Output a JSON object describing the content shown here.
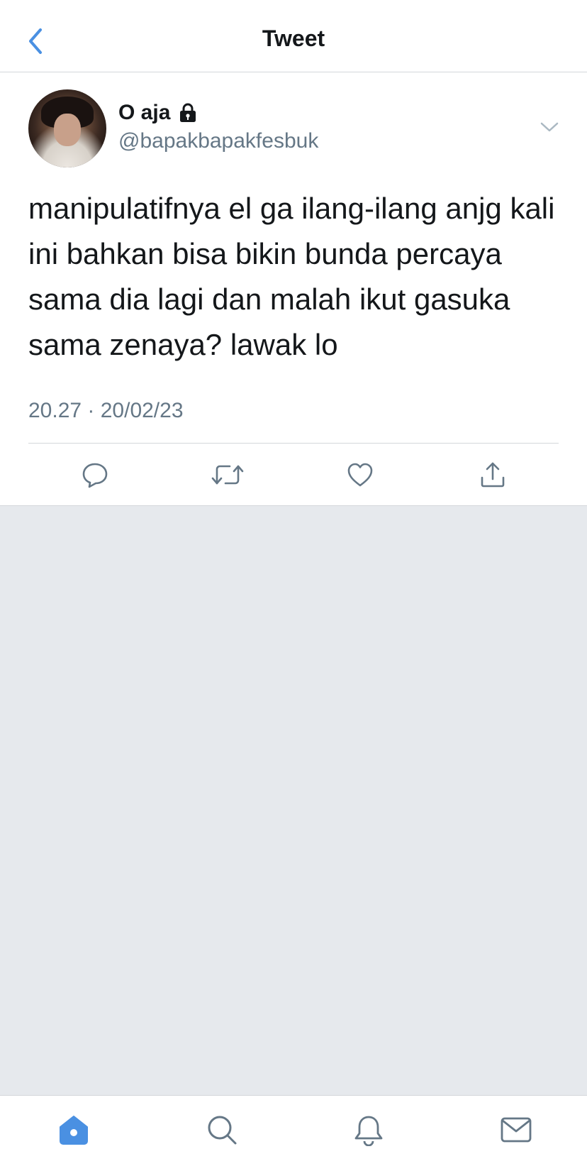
{
  "header": {
    "title": "Tweet",
    "back_icon": "chevron-left-icon",
    "accent_color": "#4a90e2"
  },
  "tweet": {
    "author_name": "O aja",
    "protected_icon": "lock-icon",
    "handle": "@bapakbapakfesbuk",
    "text": "manipulatifnya el ga ilang-ilang anjg kali ini bahkan bisa bikin bunda percaya sama dia lagi dan malah ikut gasuka sama zenaya? lawak lo",
    "timestamp": "20.27 · 20/02/23",
    "actions": [
      "reply-icon",
      "retweet-icon",
      "like-icon",
      "share-icon"
    ]
  },
  "tabbar": {
    "items": [
      "home-icon",
      "search-icon",
      "notifications-icon",
      "messages-icon"
    ],
    "active": "home-icon"
  },
  "colors": {
    "text": "#14171a",
    "secondary": "#657786",
    "icon": "#657786",
    "background_empty": "#e6e9ed"
  }
}
